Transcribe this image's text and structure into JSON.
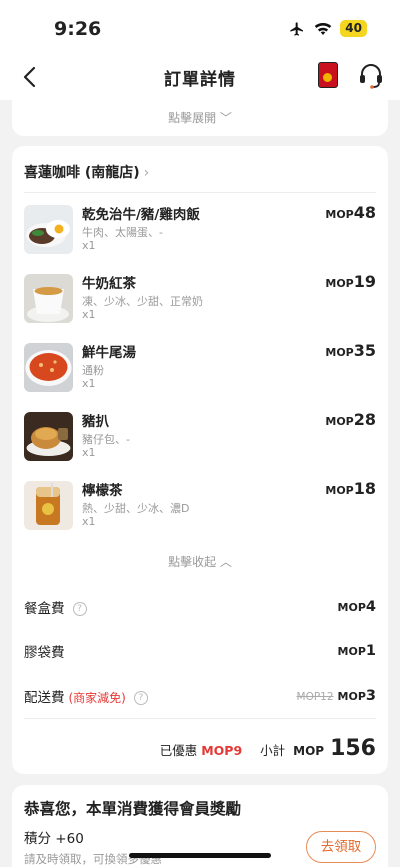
{
  "status": {
    "time": "9:26",
    "battery": "40"
  },
  "nav": {
    "title": "訂單詳情"
  },
  "top_card": {
    "expand_label": "點擊展開"
  },
  "store": {
    "name": "喜蓮咖啡 (南龍店)"
  },
  "currency": "MOP",
  "items": [
    {
      "name": "乾免治牛/豬/雞肉飯",
      "options": "牛肉、太陽蛋、-",
      "qty": "x1",
      "price": "48"
    },
    {
      "name": "牛奶紅茶",
      "options": "凍、少冰、少甜、正常奶",
      "qty": "x1",
      "price": "19"
    },
    {
      "name": "鮮牛尾湯",
      "options": "通粉",
      "qty": "x1",
      "price": "35"
    },
    {
      "name": "豬扒",
      "options": "豬仔包、-",
      "qty": "x1",
      "price": "28"
    },
    {
      "name": "檸檬茶",
      "options": "熱、少甜、少冰、濃D",
      "qty": "x1",
      "price": "18"
    }
  ],
  "collapse_label": "點擊收起",
  "fees": {
    "box": {
      "label": "餐盒費",
      "price": "4"
    },
    "bag": {
      "label": "膠袋費",
      "price": "1"
    },
    "delivery": {
      "label": "配送費",
      "tag": "(商家減免)",
      "original": "MOP12",
      "price": "3"
    }
  },
  "summary": {
    "discount_label": "已優惠",
    "discount": "MOP9",
    "subtotal_label": "小計",
    "subtotal_currency": "MOP",
    "subtotal": "156"
  },
  "reward": {
    "title": "恭喜您，本單消費獲得會員獎勵",
    "points": "積分 +60",
    "hint": "請及時領取，可換領多優惠",
    "claim_label": "去領取"
  }
}
